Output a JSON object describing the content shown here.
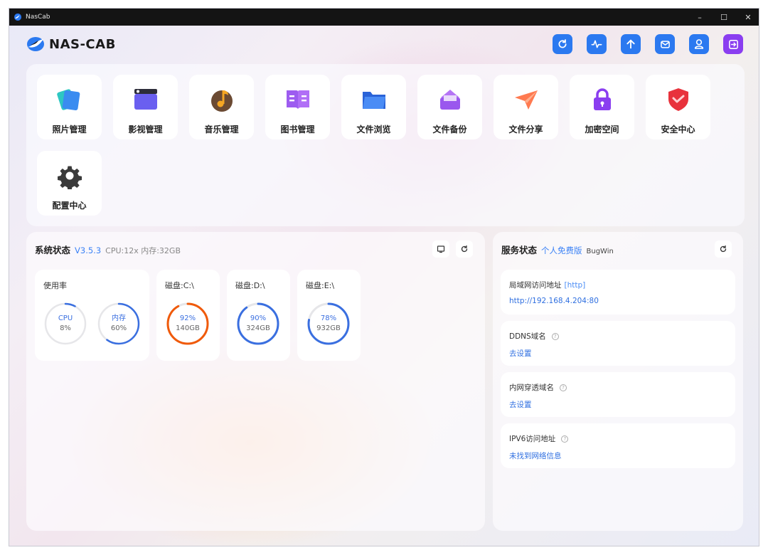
{
  "window": {
    "title": "NasCab",
    "minimize": "–",
    "maximize": "☐",
    "close": "✕"
  },
  "header": {
    "logo": "NAS-CAB",
    "buttons": [
      {
        "name": "refresh-icon",
        "color": "#2b79f0"
      },
      {
        "name": "activity-icon",
        "color": "#2b79f0"
      },
      {
        "name": "upload-icon",
        "color": "#2b79f0"
      },
      {
        "name": "mail-icon",
        "color": "#2b79f0"
      },
      {
        "name": "user-icon",
        "color": "#2b79f0"
      },
      {
        "name": "logout-icon",
        "color": "#8a3ef0"
      }
    ]
  },
  "apps": [
    {
      "label": "照片管理",
      "icon": "photos-icon"
    },
    {
      "label": "影视管理",
      "icon": "video-icon"
    },
    {
      "label": "音乐管理",
      "icon": "music-icon"
    },
    {
      "label": "图书管理",
      "icon": "book-icon"
    },
    {
      "label": "文件浏览",
      "icon": "folder-icon"
    },
    {
      "label": "文件备份",
      "icon": "backup-icon"
    },
    {
      "label": "文件分享",
      "icon": "share-icon"
    },
    {
      "label": "加密空间",
      "icon": "lock-icon"
    },
    {
      "label": "安全中心",
      "icon": "shield-icon"
    },
    {
      "label": "配置中心",
      "icon": "gear-icon"
    }
  ],
  "system": {
    "title": "系统状态",
    "version": "V3.5.3",
    "specs": "CPU:12x 内存:32GB",
    "usage_title": "使用率",
    "cpu": {
      "label": "CPU",
      "value": "8%",
      "percent": 8
    },
    "mem": {
      "label": "内存",
      "value": "60%",
      "percent": 60
    },
    "disks": [
      {
        "title": "磁盘:C:\\",
        "value": "92%",
        "size": "140GB",
        "percent": 92,
        "color": "#f05a0a"
      },
      {
        "title": "磁盘:D:\\",
        "value": "90%",
        "size": "324GB",
        "percent": 90,
        "color": "#3a6fe0"
      },
      {
        "title": "磁盘:E:\\",
        "value": "78%",
        "size": "932GB",
        "percent": 78,
        "color": "#3a6fe0"
      }
    ]
  },
  "service": {
    "title": "服务状态",
    "plan": "个人免费版",
    "user": "BugWin",
    "items": [
      {
        "label": "局域网访问地址",
        "tag": "[http]",
        "value": "http://192.168.4.204:80"
      },
      {
        "label": "DDNS域名",
        "help": "?",
        "value": "去设置"
      },
      {
        "label": "内网穿透域名",
        "help": "?",
        "value": "去设置"
      },
      {
        "label": "IPV6访问地址",
        "help": "?",
        "value": "未找到网络信息"
      }
    ]
  }
}
